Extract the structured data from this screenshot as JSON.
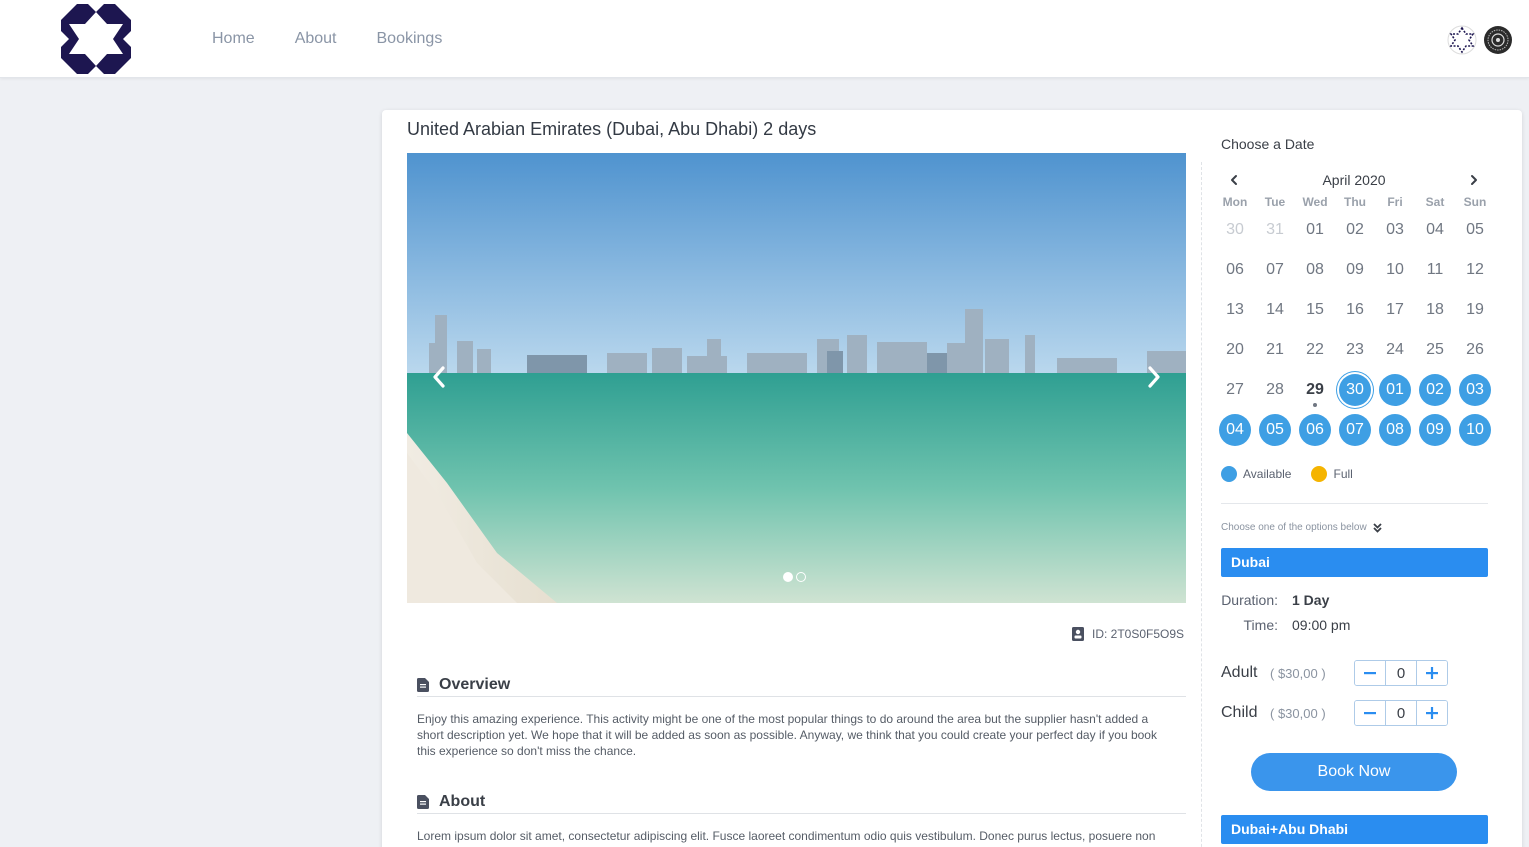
{
  "header": {
    "nav": [
      {
        "label": "Home"
      },
      {
        "label": "About"
      },
      {
        "label": "Bookings"
      }
    ]
  },
  "tour": {
    "title": "United Arabian Emirates (Dubai, Abu Dhabi) 2 days",
    "id_text": "ID: 2T0S0F5O9S",
    "slides": 2,
    "active_slide": 1
  },
  "sections": {
    "overview": {
      "heading": "Overview",
      "text": "Enjoy this amazing experience. This activity might be one of the most popular things to do around the area but the supplier hasn't added a short description yet. We hope that it will be added as soon as possible. Anyway, we think that you could create your perfect day if you book this experience so don't miss the chance."
    },
    "about": {
      "heading": "About",
      "text": "Lorem ipsum dolor sit amet, consectetur adipiscing elit. Fusce laoreet condimentum odio quis vestibulum. Donec purus lectus, posuere non"
    }
  },
  "calendar": {
    "label": "Choose a Date",
    "month": "April 2020",
    "weekdays": [
      "Mon",
      "Tue",
      "Wed",
      "Thu",
      "Fri",
      "Sat",
      "Sun"
    ],
    "weeks": [
      [
        {
          "d": "30",
          "s": "muted"
        },
        {
          "d": "31",
          "s": "muted"
        },
        {
          "d": "01",
          "s": ""
        },
        {
          "d": "02",
          "s": ""
        },
        {
          "d": "03",
          "s": ""
        },
        {
          "d": "04",
          "s": ""
        },
        {
          "d": "05",
          "s": ""
        }
      ],
      [
        {
          "d": "06",
          "s": ""
        },
        {
          "d": "07",
          "s": ""
        },
        {
          "d": "08",
          "s": ""
        },
        {
          "d": "09",
          "s": ""
        },
        {
          "d": "10",
          "s": ""
        },
        {
          "d": "11",
          "s": ""
        },
        {
          "d": "12",
          "s": ""
        }
      ],
      [
        {
          "d": "13",
          "s": ""
        },
        {
          "d": "14",
          "s": ""
        },
        {
          "d": "15",
          "s": ""
        },
        {
          "d": "16",
          "s": ""
        },
        {
          "d": "17",
          "s": ""
        },
        {
          "d": "18",
          "s": ""
        },
        {
          "d": "19",
          "s": ""
        }
      ],
      [
        {
          "d": "20",
          "s": ""
        },
        {
          "d": "21",
          "s": ""
        },
        {
          "d": "22",
          "s": ""
        },
        {
          "d": "23",
          "s": ""
        },
        {
          "d": "24",
          "s": ""
        },
        {
          "d": "25",
          "s": ""
        },
        {
          "d": "26",
          "s": ""
        }
      ],
      [
        {
          "d": "27",
          "s": ""
        },
        {
          "d": "28",
          "s": ""
        },
        {
          "d": "29",
          "s": "today"
        },
        {
          "d": "30",
          "s": "avail sel"
        },
        {
          "d": "01",
          "s": "avail"
        },
        {
          "d": "02",
          "s": "avail"
        },
        {
          "d": "03",
          "s": "avail"
        }
      ],
      [
        {
          "d": "04",
          "s": "avail"
        },
        {
          "d": "05",
          "s": "avail"
        },
        {
          "d": "06",
          "s": "avail"
        },
        {
          "d": "07",
          "s": "avail"
        },
        {
          "d": "08",
          "s": "avail"
        },
        {
          "d": "09",
          "s": "avail"
        },
        {
          "d": "10",
          "s": "avail"
        }
      ]
    ],
    "legend": [
      {
        "label": "Available",
        "color": "#3e9fe4"
      },
      {
        "label": "Full",
        "color": "#f5b400"
      }
    ]
  },
  "options": {
    "hint": "Choose one of the options below",
    "items": [
      {
        "name": "Dubai",
        "duration_label": "Duration:",
        "duration": "1 Day",
        "time_label": "Time:",
        "time": "09:00 pm",
        "pax": [
          {
            "label": "Adult",
            "price": "( $30,00 )",
            "qty": "0"
          },
          {
            "label": "Child",
            "price": "( $30,00 )",
            "qty": "0"
          }
        ],
        "book_label": "Book Now"
      },
      {
        "name": "Dubai+Abu Dhabi"
      }
    ]
  },
  "colors": {
    "accent": "#2a8df0",
    "available": "#3e9fe4",
    "full": "#f5b400",
    "logo": "#1d1650"
  }
}
